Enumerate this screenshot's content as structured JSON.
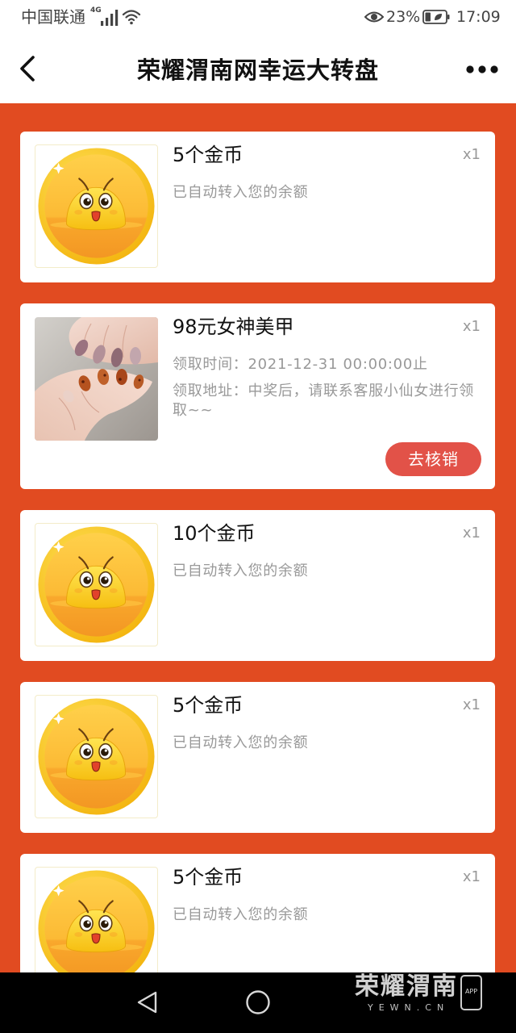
{
  "status_bar": {
    "carrier": "中国联通",
    "network": "4G",
    "battery_percent": "23%",
    "time": "17:09",
    "icons": [
      "signal-icon",
      "wifi-icon",
      "eye-comfort-icon",
      "battery-icon"
    ]
  },
  "header": {
    "title": "荣耀渭南网幸运大转盘",
    "back_icon": "chevron-left-icon",
    "more_icon": "more-dots-icon"
  },
  "prizes": [
    {
      "image_icon": "gold-coin-icon",
      "title": "5个金币",
      "quantity": "x1",
      "note": "已自动转入您的余额"
    },
    {
      "image_icon": "nail-photo",
      "title": "98元女神美甲",
      "quantity": "x1",
      "claim_time": "领取时间：2021-12-31 00:00:00止",
      "claim_address": "领取地址：中奖后，请联系客服小仙女进行领取~~",
      "action": "去核销"
    },
    {
      "image_icon": "gold-coin-icon",
      "title": "10个金币",
      "quantity": "x1",
      "note": "已自动转入您的余额"
    },
    {
      "image_icon": "gold-coin-icon",
      "title": "5个金币",
      "quantity": "x1",
      "note": "已自动转入您的余额"
    },
    {
      "image_icon": "gold-coin-icon",
      "title": "5个金币",
      "quantity": "x1",
      "note": "已自动转入您的余额"
    }
  ],
  "nav_bar": {
    "icons": [
      "back-triangle-icon",
      "home-circle-icon"
    ]
  },
  "watermark": {
    "brand": "荣耀渭南",
    "domain": "YEWN.CN",
    "badge": "APP"
  },
  "colors": {
    "page_background": "#e14b21",
    "card": "#ffffff",
    "action_button": "#e25248",
    "title_text": "#111111",
    "muted_text": "#999999",
    "nav_bar": "#000000"
  }
}
